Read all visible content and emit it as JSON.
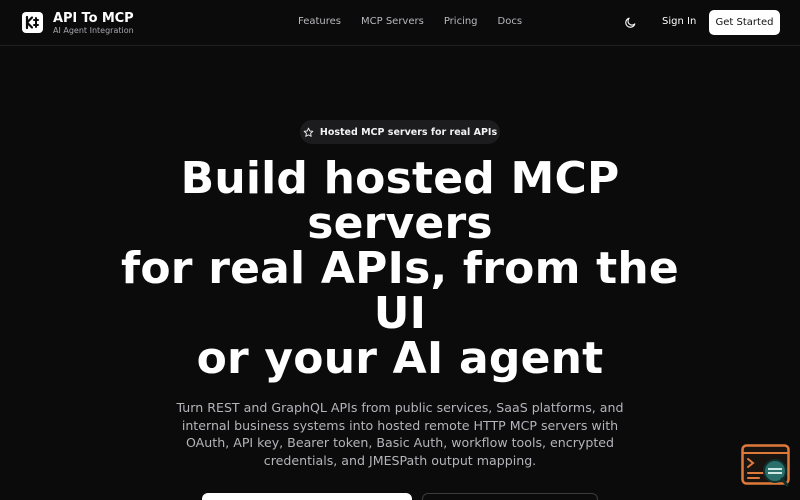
{
  "header": {
    "brand_title": "API To MCP",
    "brand_subtitle": "AI Agent Integration",
    "nav": [
      "Features",
      "MCP Servers",
      "Pricing",
      "Docs"
    ],
    "theme_icon": "moon-icon",
    "sign_in_label": "Sign In",
    "get_started_label": "Get Started"
  },
  "hero": {
    "badge_icon": "star-icon",
    "badge_label": "Hosted MCP servers for real APIs",
    "headline_lines": [
      "Build hosted MCP",
      "servers",
      "for real APIs, from the",
      "UI",
      "or your AI agent"
    ],
    "description": "Turn REST and GraphQL APIs from public services, SaaS platforms, and internal business systems into hosted remote HTTP MCP servers with OAuth, API key, Bearer token, Basic Auth, workflow tools, encrypted credentials, and JMESPath output mapping."
  },
  "widget": {
    "icon": "terminal-search-icon"
  },
  "colors": {
    "background": "#0b0b0c",
    "text_primary": "#ffffff",
    "text_muted": "#b4b4ba",
    "badge_bg": "#1c1c1f",
    "widget_accent": "#e07a3a",
    "widget_teal": "#2a6f6a"
  }
}
